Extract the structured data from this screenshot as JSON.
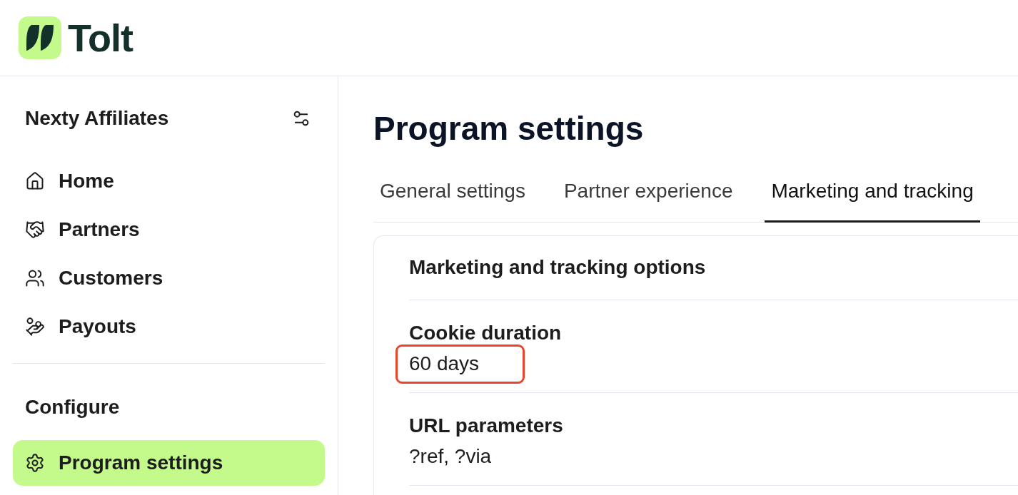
{
  "logo": {
    "text": "Tolt"
  },
  "sidebar": {
    "workspace": "Nexty Affiliates",
    "items": [
      {
        "label": "Home",
        "selected": false
      },
      {
        "label": "Partners",
        "selected": false
      },
      {
        "label": "Customers",
        "selected": false
      },
      {
        "label": "Payouts",
        "selected": false
      }
    ],
    "sections": [
      {
        "title": "Configure",
        "items": [
          {
            "label": "Program settings",
            "selected": true
          }
        ]
      }
    ]
  },
  "page": {
    "title": "Program settings"
  },
  "tabs": [
    {
      "label": "General settings",
      "selected": false
    },
    {
      "label": "Partner experience",
      "selected": false
    },
    {
      "label": "Marketing and tracking",
      "selected": true
    }
  ],
  "card": {
    "title": "Marketing and tracking options",
    "settings": [
      {
        "label": "Cookie duration",
        "value": "60 days",
        "highlighted": true
      },
      {
        "label": "URL parameters",
        "value": "?ref, ?via",
        "highlighted": false
      }
    ]
  }
}
